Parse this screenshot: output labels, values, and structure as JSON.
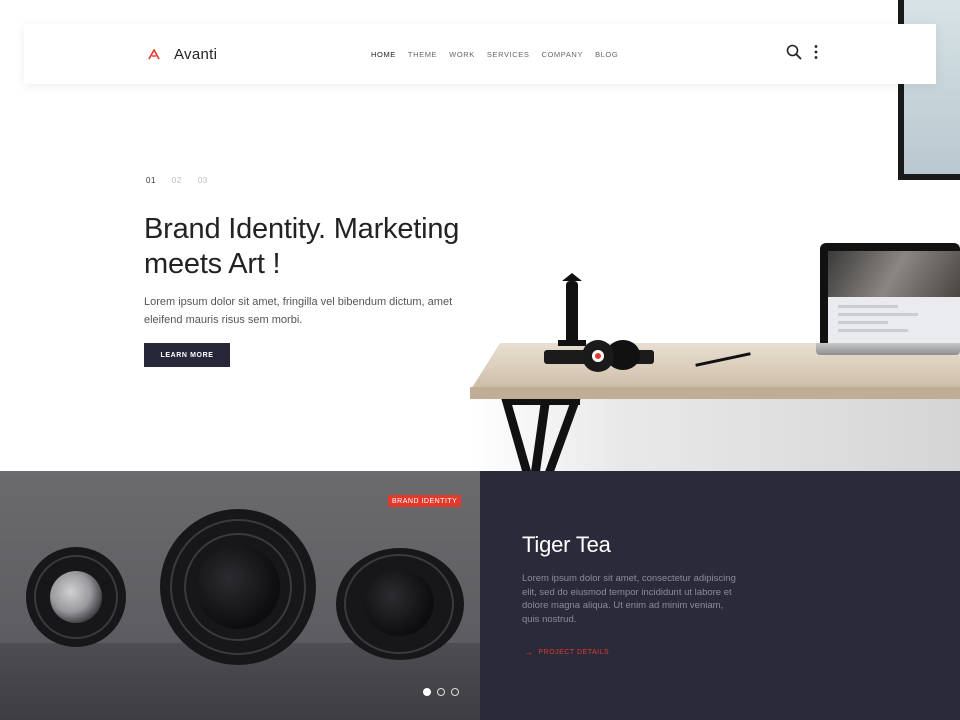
{
  "brand": {
    "name": "Avanti",
    "accent_color": "#e03a2d"
  },
  "nav": {
    "items": [
      {
        "label": "HOME",
        "active": true
      },
      {
        "label": "THEME",
        "active": false
      },
      {
        "label": "WORK",
        "active": false
      },
      {
        "label": "SERVICES",
        "active": false
      },
      {
        "label": "COMPANY",
        "active": false
      },
      {
        "label": "BLOG",
        "active": false
      }
    ],
    "icons": [
      "search-icon",
      "more-vertical-icon"
    ]
  },
  "hero": {
    "slides": [
      "01",
      "02",
      "03"
    ],
    "active_slide": "01",
    "title": "Brand Identity. Marketing meets Art !",
    "text": "Lorem ipsum dolor sit amet, fringilla vel bibendum dictum, amet eleifend mauris risus sem morbi.",
    "button_label": "LEARN MORE"
  },
  "project": {
    "tag": "BRAND IDENTITY",
    "title": "Tiger Tea",
    "text": "Lorem ipsum dolor sit amet, consectetur adipiscing elit, sed do eiusmod tempor incididunt ut labore et dolore magna aliqua. Ut enim ad minim veniam, quis nostrud.",
    "link_label": "PROJECT DETAILS",
    "carousel_dots": 3,
    "active_dot": 1,
    "panel_color": "#2b2a3a"
  }
}
